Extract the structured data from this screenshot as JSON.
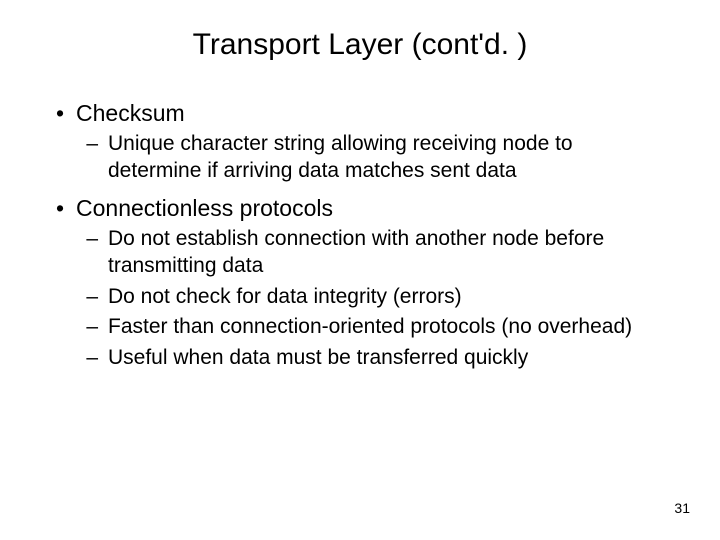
{
  "title": "Transport Layer (cont'd. )",
  "bullets": [
    {
      "text": "Checksum",
      "sub": [
        "Unique character string allowing receiving node to determine if arriving data matches sent data"
      ]
    },
    {
      "text": "Connectionless protocols",
      "sub": [
        "Do not establish connection with another node before transmitting data",
        "Do not check for data integrity (errors)",
        "Faster than connection-oriented protocols (no overhead)",
        "Useful when data must be transferred quickly"
      ]
    }
  ],
  "page_number": "31",
  "markers": {
    "l1": "•",
    "l2": "–"
  }
}
